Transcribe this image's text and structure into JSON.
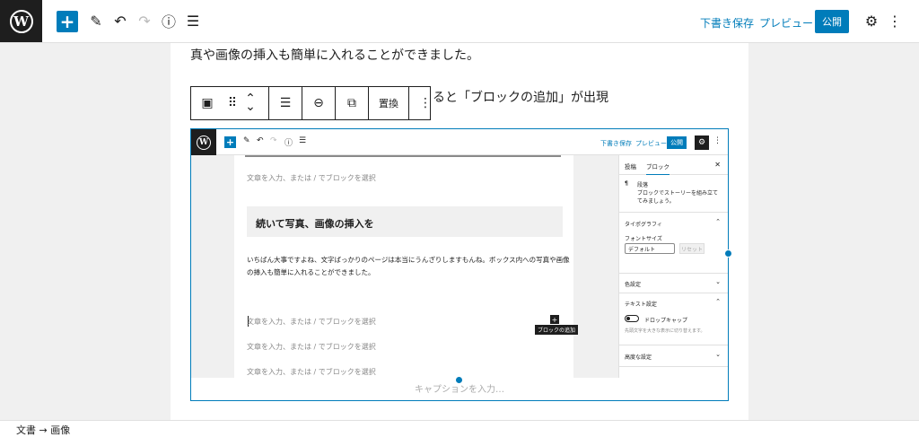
{
  "topbar": {
    "logo_letter": "W",
    "add_icon": "+",
    "tools_icon": "✎",
    "undo_icon": "↶",
    "redo_icon": "↷",
    "info_icon": "ⓘ",
    "outline_icon": "☰",
    "draft_label": "下書き保存",
    "preview_label": "プレビュー",
    "publish_label": "公開",
    "settings_icon": "⚙",
    "more_icon": "⋮"
  },
  "content": {
    "para_top": "真や画像の挿入も簡単に入れることができました。",
    "para_right": "ると「ブロックの追加」が出現"
  },
  "block_toolbar": {
    "image_icon": "▣",
    "drag_icon": "⠿",
    "move_up_icon": "⌃",
    "move_down_icon": "⌄",
    "align_icon": "☰",
    "link_icon": "⊖",
    "crop_icon": "⧉",
    "replace_label": "置換",
    "more_icon": "⋮"
  },
  "inner": {
    "draft_label": "下書き保存",
    "preview_label": "プレビュー",
    "publish_label": "公開",
    "placeholder": "文章を入力、または / でブロックを選択",
    "heading": "続いて写真、画像の挿入を",
    "body": "いちばん大事ですよね、文字ばっかりのページは本当にうんざりしますもんね。ボックス内への写真や画像の挿入も簡単に入れることができました。",
    "tooltip": "ブロックの追加",
    "caption_placeholder": "キャプションを入力…",
    "sidebar": {
      "tab_post": "投稿",
      "tab_block": "ブロック",
      "close_icon": "✕",
      "block_name": "段落",
      "block_desc": "ブロックでストーリーを組み立ててみましょう。",
      "typography": "タイポグラフィ",
      "font_size_label": "フォントサイズ",
      "font_size_value": "デフォルト",
      "reset_label": "リセット",
      "color": "色設定",
      "text_settings": "テキスト設定",
      "drop_cap": "ドロップキャップ",
      "drop_cap_help": "先頭文字を大きな表示に切り替えます。",
      "advanced": "高度な設定"
    }
  },
  "breadcrumb": {
    "item1": "文書",
    "sep": "→",
    "item2": "画像"
  }
}
